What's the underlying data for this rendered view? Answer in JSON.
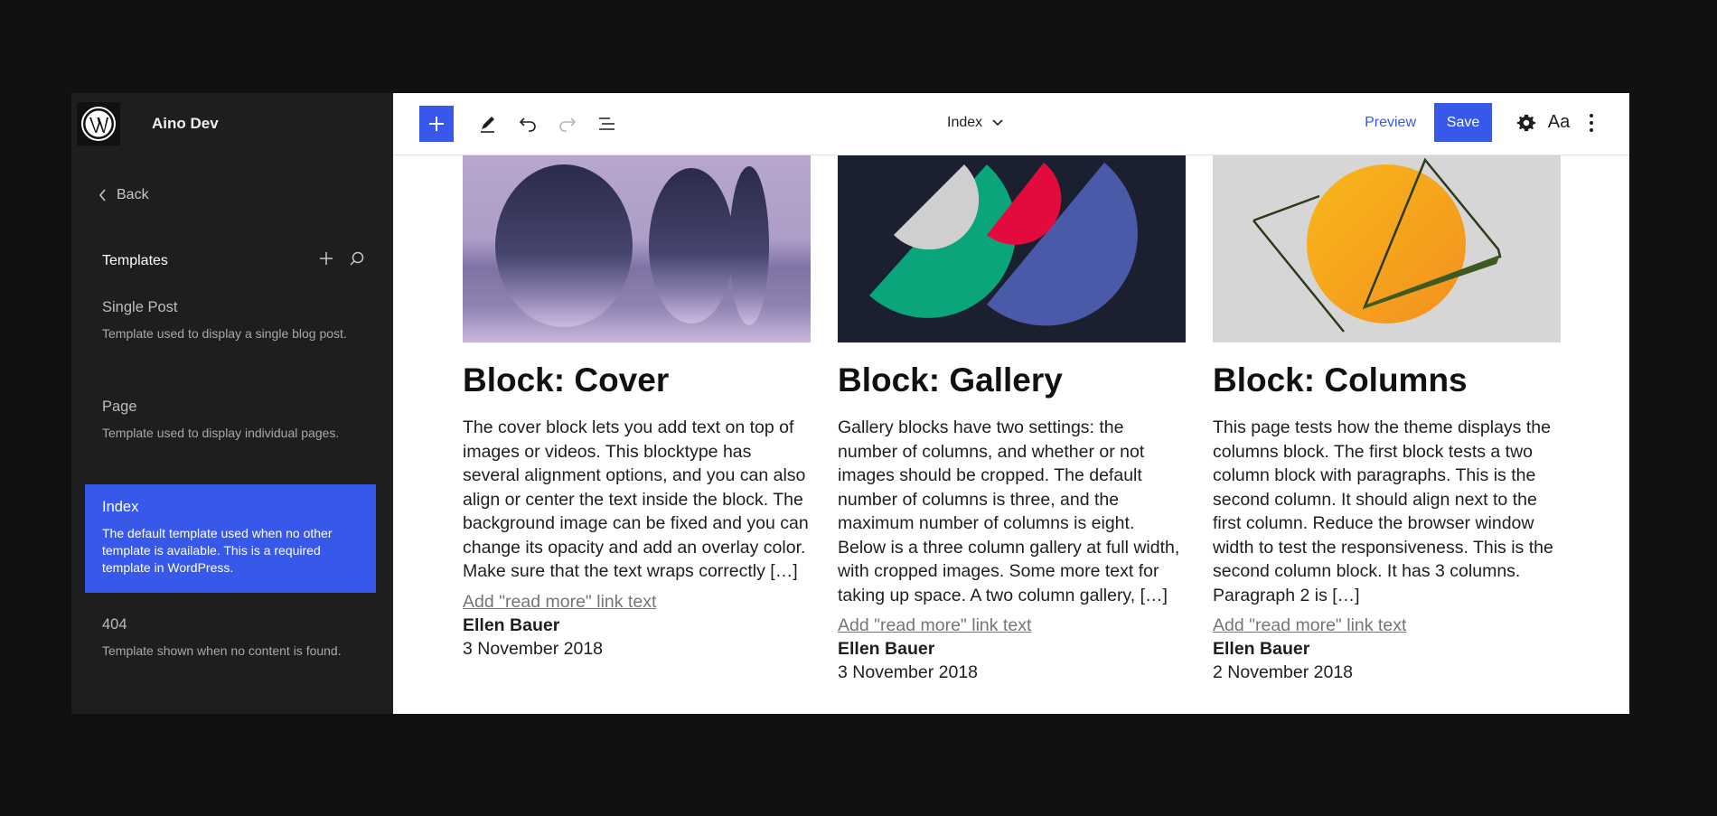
{
  "site": {
    "name": "Aino Dev"
  },
  "sidebar": {
    "back_label": "Back",
    "section_title": "Templates",
    "templates": [
      {
        "title": "Single Post",
        "description": "Template used to display a single blog post."
      },
      {
        "title": "Page",
        "description": "Template used to display individual pages."
      },
      {
        "title": "Index",
        "description": "The default template used when no other template is available. This is a required template in WordPress.",
        "active": true
      },
      {
        "title": "404",
        "description": "Template shown when no content is found."
      }
    ]
  },
  "toolbar": {
    "document_title": "Index",
    "preview_label": "Preview",
    "save_label": "Save",
    "styles_label": "Aa"
  },
  "posts": [
    {
      "title": "Block: Cover",
      "excerpt": "The cover block lets you add text on top of images or videos. This blocktype has several alignment options, and you can also align or center the text inside the block. The background image can be fixed and you can change its opacity and add an overlay color. Make sure that the text wraps correctly […]",
      "read_more": "Add \"read more\" link text",
      "author": "Ellen Bauer",
      "date": "3 November 2018"
    },
    {
      "title": "Block: Gallery",
      "excerpt": "Gallery blocks have two settings: the number of columns, and whether or not images should be cropped. The default number of columns is three, and the maximum number of columns is eight. Below is a three column gallery at full width, with cropped images. Some more text for taking up space. A two column gallery, […]",
      "read_more": "Add \"read more\" link text",
      "author": "Ellen Bauer",
      "date": "3 November 2018"
    },
    {
      "title": "Block: Columns",
      "excerpt": "This page tests how the theme displays the columns block. The first block tests a two column block with paragraphs. This is the second column. It should align next to the first column. Reduce the browser window width to test the responsiveness. This is the second column block. It has 3 columns. Paragraph 2 is […]",
      "read_more": "Add \"read more\" link text",
      "author": "Ellen Bauer",
      "date": "2 November 2018"
    }
  ],
  "colors": {
    "accent": "#3858e9",
    "sidebar_bg": "#1e1e1e",
    "page_bg": "#111111"
  }
}
